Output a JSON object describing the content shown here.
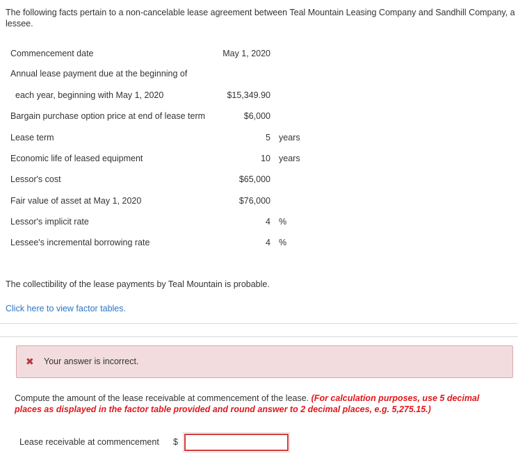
{
  "intro": "The following facts pertain to a non-cancelable lease agreement between Teal Mountain Leasing Company and Sandhill Company, a lessee.",
  "facts": [
    {
      "label": "Commencement date",
      "value": "May 1, 2020",
      "unit": ""
    },
    {
      "label": "Annual lease payment due at the beginning of",
      "value": "",
      "unit": ""
    },
    {
      "label": "each year, beginning with May 1, 2020",
      "value": "$15,349.90",
      "unit": ""
    },
    {
      "label": "Bargain purchase option price at end of lease term",
      "value": "$6,000",
      "unit": ""
    },
    {
      "label": "Lease term",
      "value": "5",
      "unit": "years"
    },
    {
      "label": "Economic life of leased equipment",
      "value": "10",
      "unit": "years"
    },
    {
      "label": "Lessor's cost",
      "value": "$65,000",
      "unit": ""
    },
    {
      "label": "Fair value of asset at May 1, 2020",
      "value": "$76,000",
      "unit": ""
    },
    {
      "label": "Lessor's implicit rate",
      "value": "4",
      "unit": "%"
    },
    {
      "label": "Lessee's incremental borrowing rate",
      "value": "4",
      "unit": "%"
    }
  ],
  "collectibility": "The collectibility of the lease payments by Teal Mountain is probable.",
  "factor_link": "Click here to view factor tables.",
  "alert": {
    "icon": "✖",
    "text": "Your answer is incorrect."
  },
  "question": {
    "text": "Compute the amount of the lease receivable at commencement of the lease. ",
    "hint": "(For calculation purposes, use 5 decimal places as displayed in the factor table provided and round answer to 2 decimal places, e.g. 5,275.15.)"
  },
  "answer": {
    "label": "Lease receivable at commencement",
    "currency": "$",
    "value": ""
  },
  "colors": {
    "link": "#2a76c6",
    "error": "#e0161b",
    "alert_bg": "#f2dcde",
    "alert_icon": "#b8353f"
  }
}
